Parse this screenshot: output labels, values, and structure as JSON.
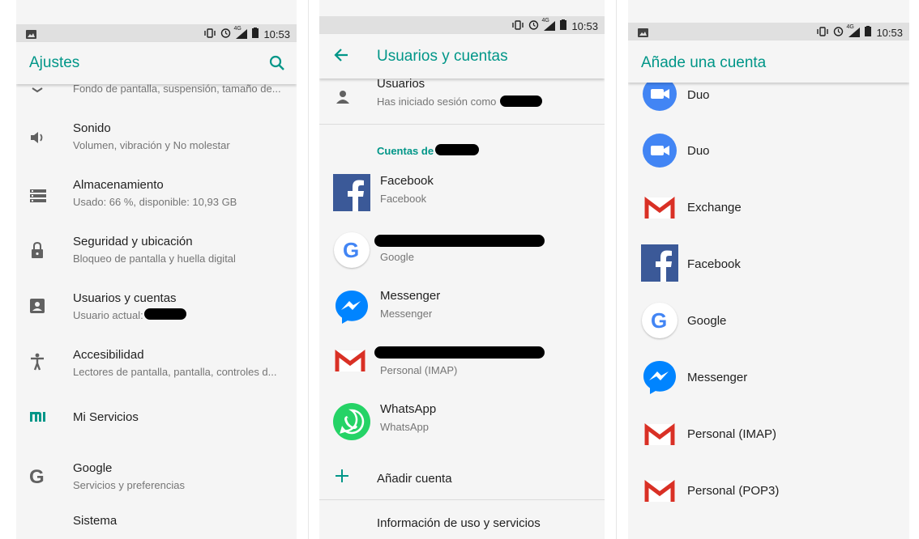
{
  "status_bar": {
    "time": "10:53",
    "network": "4G"
  },
  "settings": {
    "title": "Ajustes",
    "items": [
      {
        "title": "",
        "sub": "Fondo de pantalla, suspensión, tamaño de..."
      },
      {
        "title": "Sonido",
        "sub": "Volumen, vibración y No molestar"
      },
      {
        "title": "Almacenamiento",
        "sub": "Usado: 66 %, disponible: 10,93 GB"
      },
      {
        "title": "Seguridad y ubicación",
        "sub": "Bloqueo de pantalla y huella digital"
      },
      {
        "title": "Usuarios y cuentas",
        "sub": "Usuario actual:"
      },
      {
        "title": "Accesibilidad",
        "sub": "Lectores de pantalla, pantalla, controles d..."
      },
      {
        "title": "Mi Servicios",
        "sub": ""
      },
      {
        "title": "Google",
        "sub": "Servicios y preferencias"
      },
      {
        "title": "Sistema",
        "sub": ""
      }
    ]
  },
  "users_accounts": {
    "title": "Usuarios y cuentas",
    "users": {
      "title": "Usuarios",
      "sub": "Has iniciado sesión como"
    },
    "section_header": "Cuentas de",
    "accounts": [
      {
        "title": "Facebook",
        "sub": "Facebook"
      },
      {
        "title": "",
        "sub": "Google"
      },
      {
        "title": "Messenger",
        "sub": "Messenger"
      },
      {
        "title": "",
        "sub": "Personal (IMAP)"
      },
      {
        "title": "WhatsApp",
        "sub": "WhatsApp"
      }
    ],
    "add_account": "Añadir cuenta",
    "bottom_item": "Información de uso y servicios"
  },
  "add_account": {
    "title": "Añade una cuenta",
    "items": [
      "Duo",
      "Duo",
      "Exchange",
      "Facebook",
      "Google",
      "Messenger",
      "Personal (IMAP)",
      "Personal (POP3)"
    ]
  },
  "colors": {
    "accent": "#009688",
    "facebook": "#3b5998",
    "messenger": "#0084ff",
    "whatsapp": "#25d366",
    "gmail": "#d93025",
    "duo": "#4285f4"
  }
}
